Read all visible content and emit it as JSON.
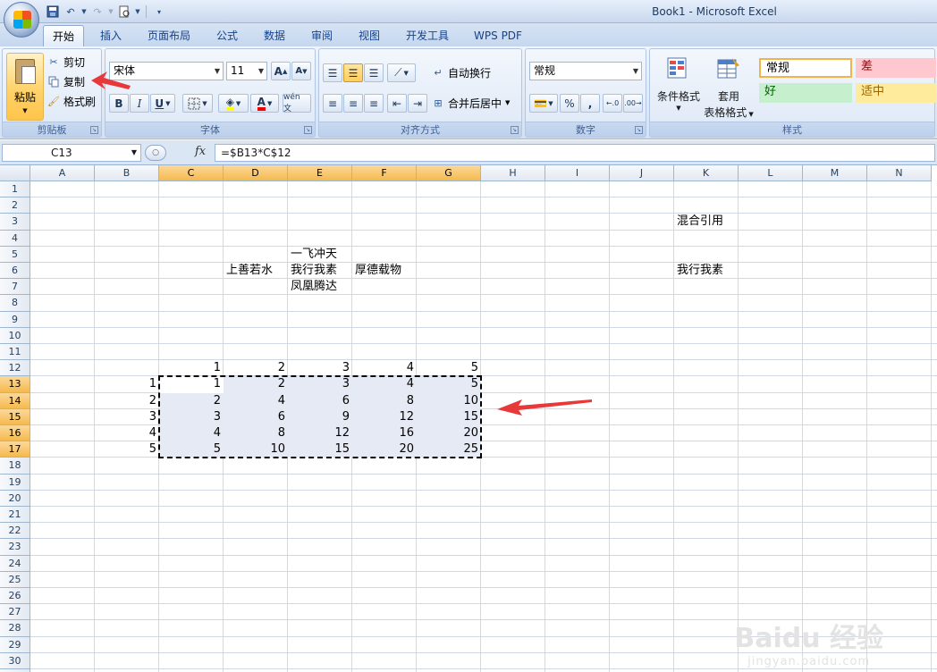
{
  "window": {
    "title": "Book1 - Microsoft Excel"
  },
  "quick_access": [
    "save-icon",
    "undo-icon",
    "redo-icon",
    "print-preview-icon",
    "customize-icon"
  ],
  "tabs": [
    {
      "label": "开始",
      "active": true
    },
    {
      "label": "插入"
    },
    {
      "label": "页面布局"
    },
    {
      "label": "公式"
    },
    {
      "label": "数据"
    },
    {
      "label": "审阅"
    },
    {
      "label": "视图"
    },
    {
      "label": "开发工具"
    },
    {
      "label": "WPS PDF"
    }
  ],
  "ribbon": {
    "clipboard": {
      "paste": "粘贴",
      "cut": "剪切",
      "copy": "复制",
      "format_painter": "格式刷",
      "label": "剪贴板"
    },
    "font": {
      "name": "宋体",
      "size": "11",
      "bold": "B",
      "italic": "I",
      "underline": "U",
      "grow": "A",
      "shrink": "A",
      "font_color": "A",
      "phonetic": "wén 文",
      "label": "字体"
    },
    "alignment": {
      "wrap_text": "自动换行",
      "merge_center": "合并后居中",
      "label": "对齐方式"
    },
    "number": {
      "format": "常规",
      "percent": "%",
      "comma": ",",
      "label": "数字"
    },
    "styles": {
      "conditional": "条件格式",
      "table_top": "套用",
      "table_bottom": "表格格式",
      "normal": "常规",
      "bad": "差",
      "good": "好",
      "neutral": "适中",
      "label": "样式",
      "colors": {
        "normal_border": "#f0b44a",
        "bad_bg": "#ffc7ce",
        "good_bg": "#c6efce",
        "neutral_bg": "#ffeb9c"
      }
    }
  },
  "formula_bar": {
    "name_box": "C13",
    "fx": "fx",
    "formula": "=$B13*C$12"
  },
  "sheet": {
    "columns": [
      "A",
      "B",
      "C",
      "D",
      "E",
      "F",
      "G",
      "H",
      "I",
      "J",
      "K",
      "L",
      "M",
      "N"
    ],
    "rows": [
      "1",
      "2",
      "3",
      "4",
      "5",
      "6",
      "7",
      "8",
      "9",
      "10",
      "11",
      "12",
      "13",
      "14",
      "15",
      "16",
      "17",
      "18",
      "19",
      "20",
      "21",
      "22",
      "23",
      "24",
      "25",
      "26",
      "27",
      "28",
      "29",
      "30",
      "31"
    ],
    "selected_columns": [
      "C",
      "D",
      "E",
      "F",
      "G"
    ],
    "selected_rows": [
      "13",
      "14",
      "15",
      "16",
      "17"
    ],
    "cells": {
      "K3": "混合引用",
      "D6": "上善若水",
      "E5": "一飞冲天",
      "E6": "我行我素",
      "E7": "凤凰腾达",
      "F6": "厚德载物",
      "K6": "我行我素",
      "C12": "1",
      "D12": "2",
      "E12": "3",
      "F12": "4",
      "G12": "5",
      "B13": "1",
      "B14": "2",
      "B15": "3",
      "B16": "4",
      "B17": "5",
      "C13": "1",
      "D13": "2",
      "E13": "3",
      "F13": "4",
      "G13": "5",
      "C14": "2",
      "D14": "4",
      "E14": "6",
      "F14": "8",
      "G14": "10",
      "C15": "3",
      "D15": "6",
      "E15": "9",
      "F15": "12",
      "G15": "15",
      "C16": "4",
      "D16": "8",
      "E16": "12",
      "F16": "16",
      "G16": "20",
      "C17": "5",
      "D17": "10",
      "E17": "15",
      "F17": "20",
      "G17": "25"
    }
  },
  "watermark": {
    "brand": "Baidu 经验",
    "url": "jingyan.baidu.com"
  },
  "accent_colors": {
    "annotation_arrow": "#e8393a",
    "selection_header": "#f5b94e"
  }
}
